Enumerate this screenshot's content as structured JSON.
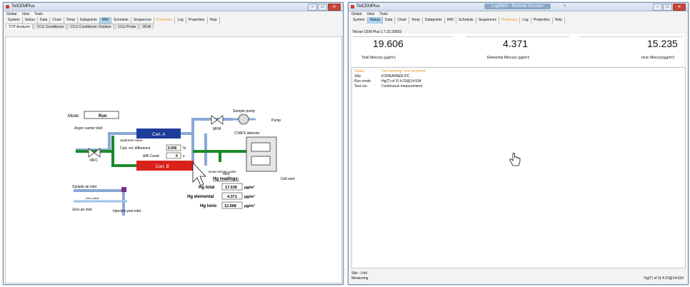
{
  "left_window": {
    "title": "TelCEMPlus",
    "menu": [
      "Global",
      "View",
      "Tools"
    ],
    "toolbar": [
      {
        "label": "System",
        "state": ""
      },
      {
        "label": "Status",
        "state": ""
      },
      {
        "label": "Data",
        "state": ""
      },
      {
        "label": "Chart",
        "state": ""
      },
      {
        "label": "Temp",
        "state": ""
      },
      {
        "label": "Datapoints",
        "state": ""
      },
      {
        "label": "HMI",
        "state": "active"
      },
      {
        "label": "Schedule",
        "state": ""
      },
      {
        "label": "Sequences",
        "state": ""
      },
      {
        "label": "Protection",
        "state": "orange"
      },
      {
        "label": "Log",
        "state": ""
      },
      {
        "label": "Properties",
        "state": ""
      },
      {
        "label": "Help",
        "state": ""
      }
    ],
    "subtabs": [
      {
        "label": "TCP Analyzer",
        "state": "active"
      },
      {
        "label": "CCU Conditioner",
        "state": ""
      },
      {
        "label": "CCU Conditioner Oxidizer",
        "state": ""
      },
      {
        "label": "CCU Probe",
        "state": ""
      },
      {
        "label": "DDIA",
        "state": ""
      }
    ],
    "diagram": {
      "mode_label": "Mode:",
      "mode_value": "Run",
      "argon_inlet": "Argon carrier inlet",
      "mfc": "MFC",
      "upstream_valve": "Upstream valve",
      "cart_a": "Cart. A",
      "cart_b": "Cart. B",
      "cart_rel_diff_label": "Cart. rel. difference",
      "cart_rel_diff_value": "0.006",
      "cart_rel_diff_unit": "%",
      "ab_count_label": "A/B Count",
      "ab_count_value": "0",
      "ab_count_unit": "s",
      "sample_pump": "Sample pump",
      "pump": "Pump",
      "mfm": "MFM",
      "cvafs": "CVAFS detector",
      "downstream_valve": "Down-stream valve",
      "vent": "vent",
      "cell_vent": "Cell vent",
      "sample_air_inlet": "Sample air inlet",
      "zero_valve": "Zero valve",
      "zero_air_inlet": "Zero air inlet",
      "injection_port": "Injection port inlet",
      "hg_readings": "Hg readings:",
      "hg_total_label": "Hg total",
      "hg_total_value": "17.039",
      "hg_elemental_label": "Hg elemental",
      "hg_elemental_value": "4.371",
      "hg_ionic_label": "Hg ionic",
      "hg_ionic_value": "12.668",
      "unit": "µg/m³"
    }
  },
  "right_window": {
    "title": "TelCEMPlus",
    "center_title": "LogMeIn - Remote Session",
    "menu": [
      "Global",
      "View",
      "Tools"
    ],
    "toolbar": [
      {
        "label": "System",
        "state": ""
      },
      {
        "label": "Status",
        "state": "active"
      },
      {
        "label": "Data",
        "state": ""
      },
      {
        "label": "Chart",
        "state": ""
      },
      {
        "label": "Temp",
        "state": ""
      },
      {
        "label": "Datapoints",
        "state": ""
      },
      {
        "label": "HMI",
        "state": ""
      },
      {
        "label": "Schedule",
        "state": ""
      },
      {
        "label": "Sequences",
        "state": ""
      },
      {
        "label": "Protection",
        "state": "orange"
      },
      {
        "label": "Log",
        "state": ""
      },
      {
        "label": "Properties",
        "state": ""
      },
      {
        "label": "Help",
        "state": ""
      }
    ],
    "version": "Tekran CEM Plus 1.7.22.30603",
    "readouts": [
      {
        "value": "19.606",
        "label": "Total Mercury (µg/m³)"
      },
      {
        "value": "4.371",
        "label": "Elemental Mercury (µg/m³)"
      },
      {
        "value": "15.235",
        "label": "Ionic Mercury(µg/m³)"
      }
    ],
    "info": [
      {
        "key": "Status",
        "value": "One warning, one comment",
        "warn": true
      },
      {
        "key": "SAs",
        "value": "KOREAPAER-PC",
        "warn": false
      },
      {
        "key": "Run mode",
        "value": "Hg(T) of 3) 4:23@14:534",
        "warn": false
      },
      {
        "key": "Test run",
        "value": "Continuous measurement",
        "warn": false
      }
    ],
    "status_left_1": "Site - Unit",
    "status_left_2": "Measuring",
    "status_right": "Hg(T) of 3) 4:23@14:534"
  },
  "colors": {
    "cart_a": "#1e3d9a",
    "cart_b": "#d9221c",
    "green_pipe": "#1c8a2a",
    "blue_pipe": "#8aa8d8",
    "light_pipe": "#9fc4e8",
    "accent": "#a9d3f2",
    "warn": "#e89b2b"
  }
}
